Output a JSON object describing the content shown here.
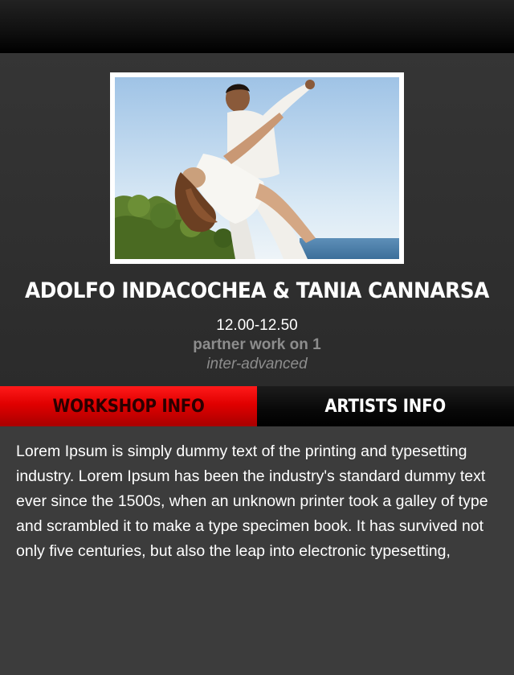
{
  "event": {
    "artists": "ADOLFO INDACOCHEA & TANIA CANNARSA",
    "time": "12.00-12.50",
    "class_name": "partner work on 1",
    "level": "inter-advanced"
  },
  "photo": {
    "icon": "dancers-photo"
  },
  "tabs": [
    {
      "label": "WORKSHOP INFO",
      "active": true
    },
    {
      "label": "ARTISTS INFO",
      "active": false
    }
  ],
  "description": "Lorem Ipsum is simply dummy text of the printing and typesetting industry. Lorem Ipsum has been the industry's standard dummy text ever since the 1500s, when an unknown printer took a galley of type and scrambled it to make a type specimen book. It has survived not only five centuries, but also the leap into electronic typesetting,",
  "colors": {
    "active_tab": "#e00000",
    "inactive_tab": "#000000",
    "background": "#2f2f2f",
    "content_background": "#3c3c3c",
    "muted_text": "#8d8d8d"
  }
}
